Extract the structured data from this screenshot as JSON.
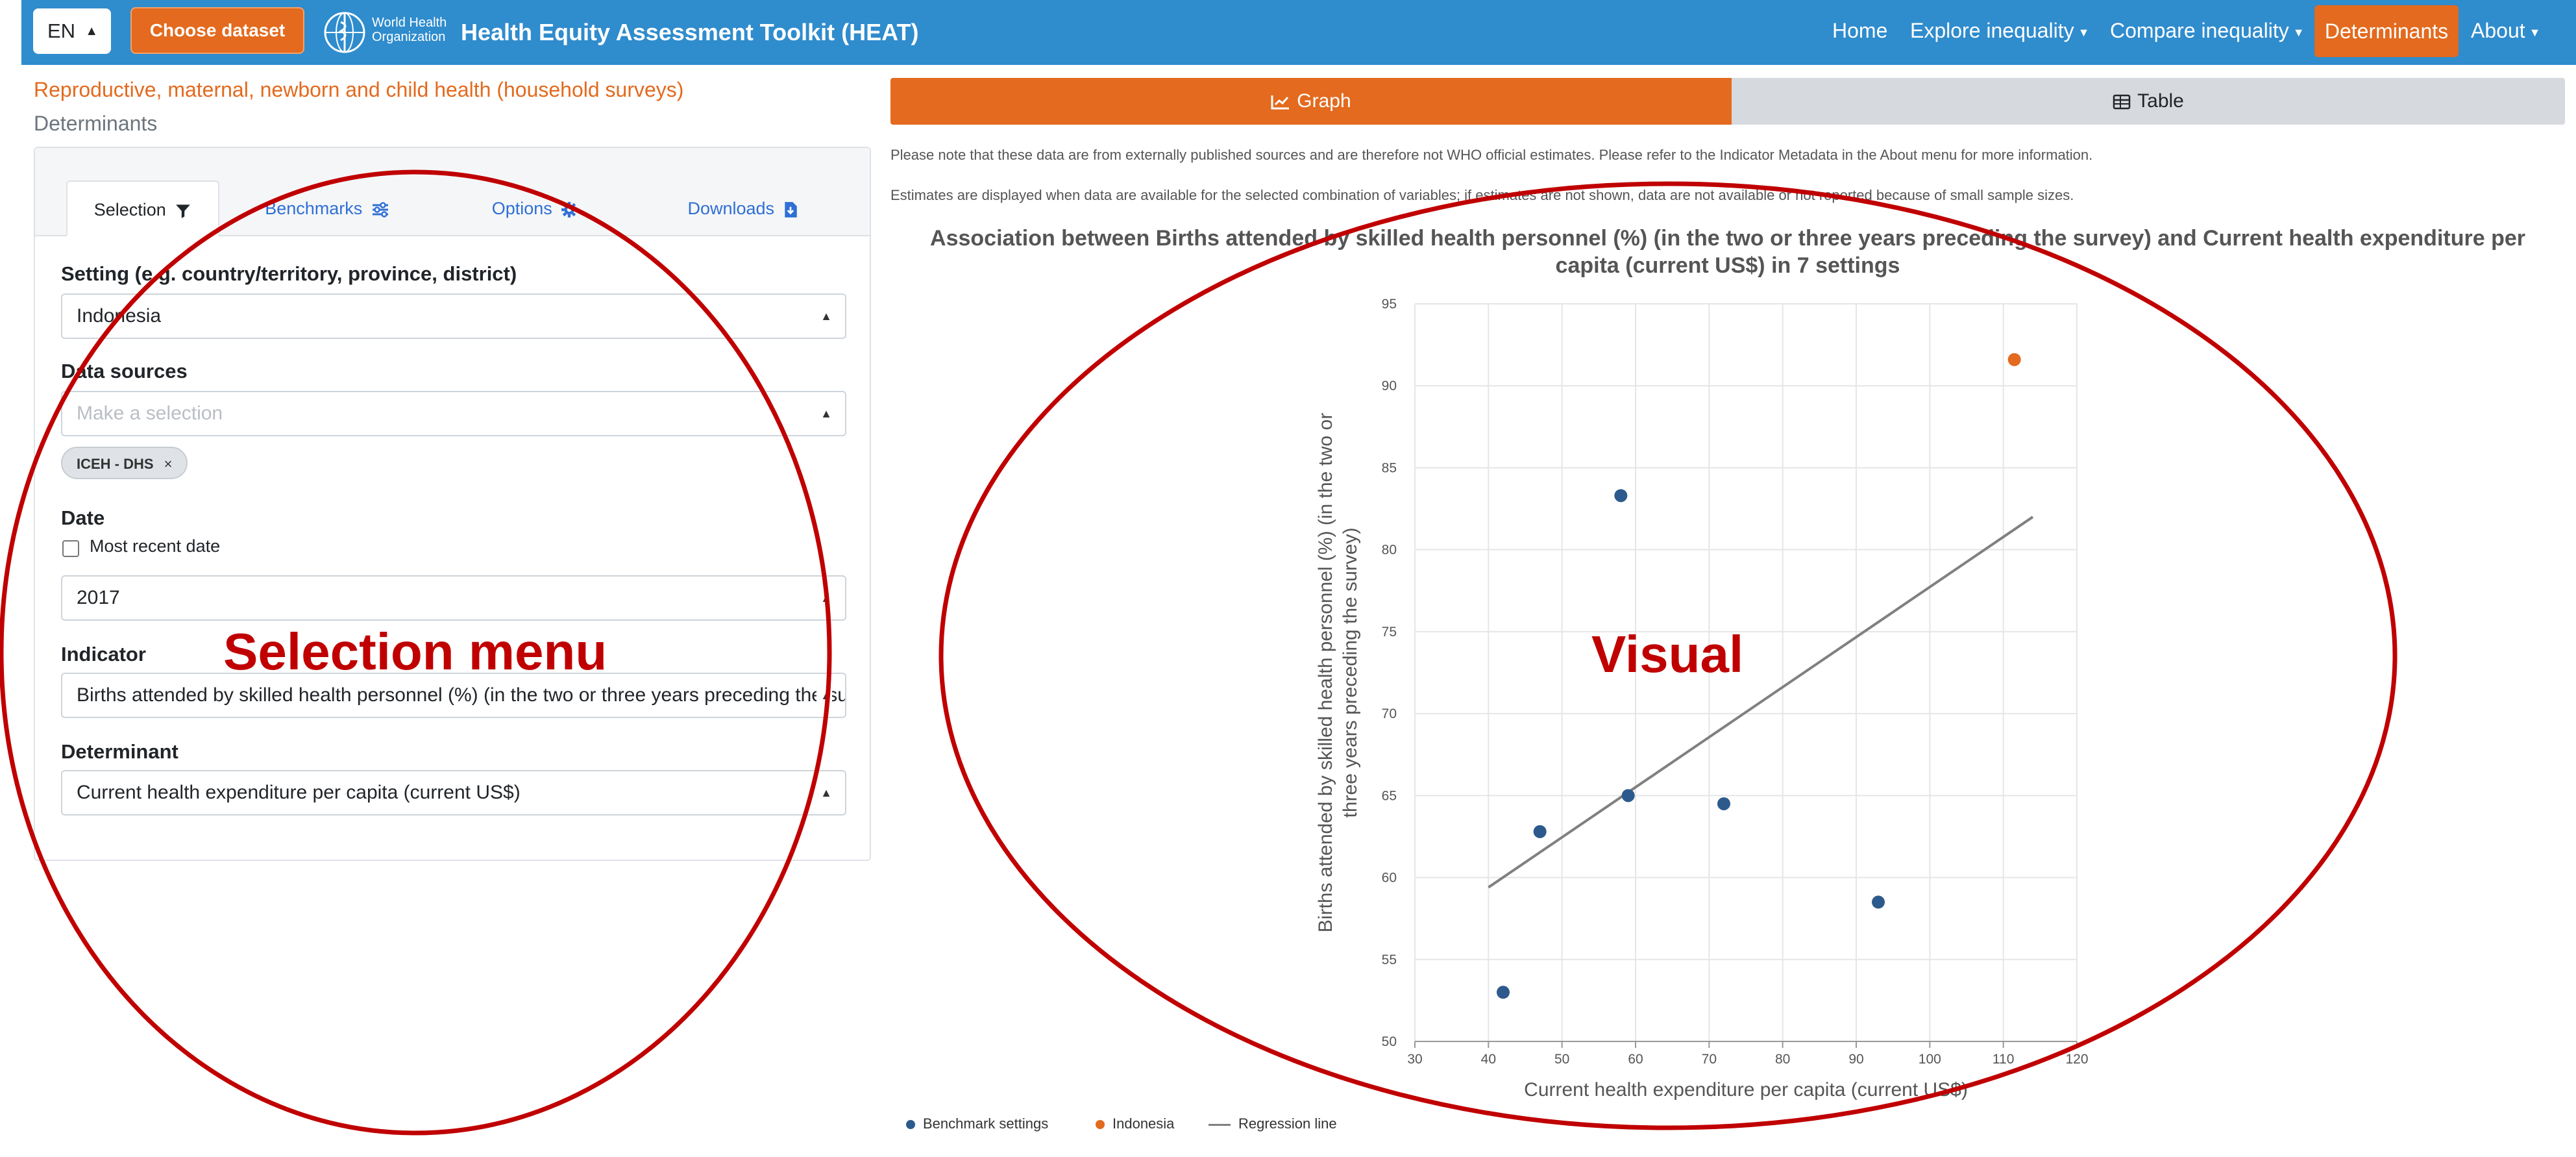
{
  "navbar": {
    "language": "EN",
    "choose_dataset": "Choose dataset",
    "who_line1": "World Health",
    "who_line2": "Organization",
    "title": "Health Equity Assessment Toolkit (HEAT)",
    "items": [
      {
        "label": "Home"
      },
      {
        "label": "Explore inequality"
      },
      {
        "label": "Compare inequality"
      },
      {
        "label": "Determinants"
      },
      {
        "label": "About"
      }
    ],
    "colors": {
      "bar": "#2f8ccd",
      "accent": "#e36a1e"
    }
  },
  "left": {
    "area_title": "Reproductive, maternal, newborn and child health (household surveys)",
    "area_subtitle": "Determinants",
    "tabs": [
      {
        "label": "Selection",
        "icon": "filter-icon"
      },
      {
        "label": "Benchmarks",
        "icon": "sliders-icon"
      },
      {
        "label": "Options",
        "icon": "gear-icon"
      },
      {
        "label": "Downloads",
        "icon": "file-download-icon"
      }
    ],
    "setting": {
      "label": "Setting (e.g. country/territory, province, district)",
      "value": "Indonesia"
    },
    "data_sources": {
      "label": "Data sources",
      "placeholder": "Make a selection",
      "chip": "ICEH - DHS"
    },
    "date": {
      "label": "Date",
      "most_recent_label": "Most recent date",
      "most_recent_checked": false,
      "value": "2017"
    },
    "indicator": {
      "label": "Indicator",
      "value": "Births attended by skilled health personnel (%) (in the two or three years preceding the survey)"
    },
    "determinant": {
      "label": "Determinant",
      "value": "Current health expenditure per capita (current US$)"
    }
  },
  "right": {
    "graph_tab": "Graph",
    "table_tab": "Table",
    "note1": "Please note that these data are from externally published sources and are therefore not WHO official estimates. Please refer to the Indicator Metadata in the About menu for more information.",
    "note2": "Estimates are displayed when data are available for the selected combination of variables; if estimates are not shown, data are not available or not reported because of small sample sizes."
  },
  "chart_data": {
    "type": "scatter",
    "title_line1": "Association between Births attended by skilled health personnel (%) (in the two or three years preceding the survey) and Current health expenditure per",
    "title_line2": "capita (current US$) in 7 settings",
    "xlabel": "Current health expenditure per capita (current US$)",
    "ylabel_line1": "Births attended by skilled health personnel (%) (in the two or",
    "ylabel_line2": "three years preceding the survey)",
    "xlim": [
      30,
      120
    ],
    "ylim": [
      50,
      95
    ],
    "xticks": [
      30,
      40,
      50,
      60,
      70,
      80,
      90,
      100,
      110,
      120
    ],
    "yticks": [
      50,
      55,
      60,
      65,
      70,
      75,
      80,
      85,
      90,
      95
    ],
    "grid": true,
    "legend_position": "bottom-left",
    "series": [
      {
        "name": "Benchmark settings",
        "color": "#2c5a8c",
        "points": [
          {
            "x": 42,
            "y": 53
          },
          {
            "x": 47,
            "y": 62.8
          },
          {
            "x": 58,
            "y": 83.3
          },
          {
            "x": 59,
            "y": 65
          },
          {
            "x": 72,
            "y": 64.5
          },
          {
            "x": 93,
            "y": 58.5
          }
        ]
      },
      {
        "name": "Indonesia",
        "color": "#e36a1e",
        "points": [
          {
            "x": 111.5,
            "y": 91.6
          }
        ]
      }
    ],
    "regression": {
      "name": "Regression line",
      "color": "#808080",
      "x": [
        40,
        114
      ],
      "y": [
        59.4,
        82
      ]
    }
  },
  "annotations": {
    "selection_label": "Selection menu",
    "visual_label": "Visual",
    "color": "#c00000"
  }
}
